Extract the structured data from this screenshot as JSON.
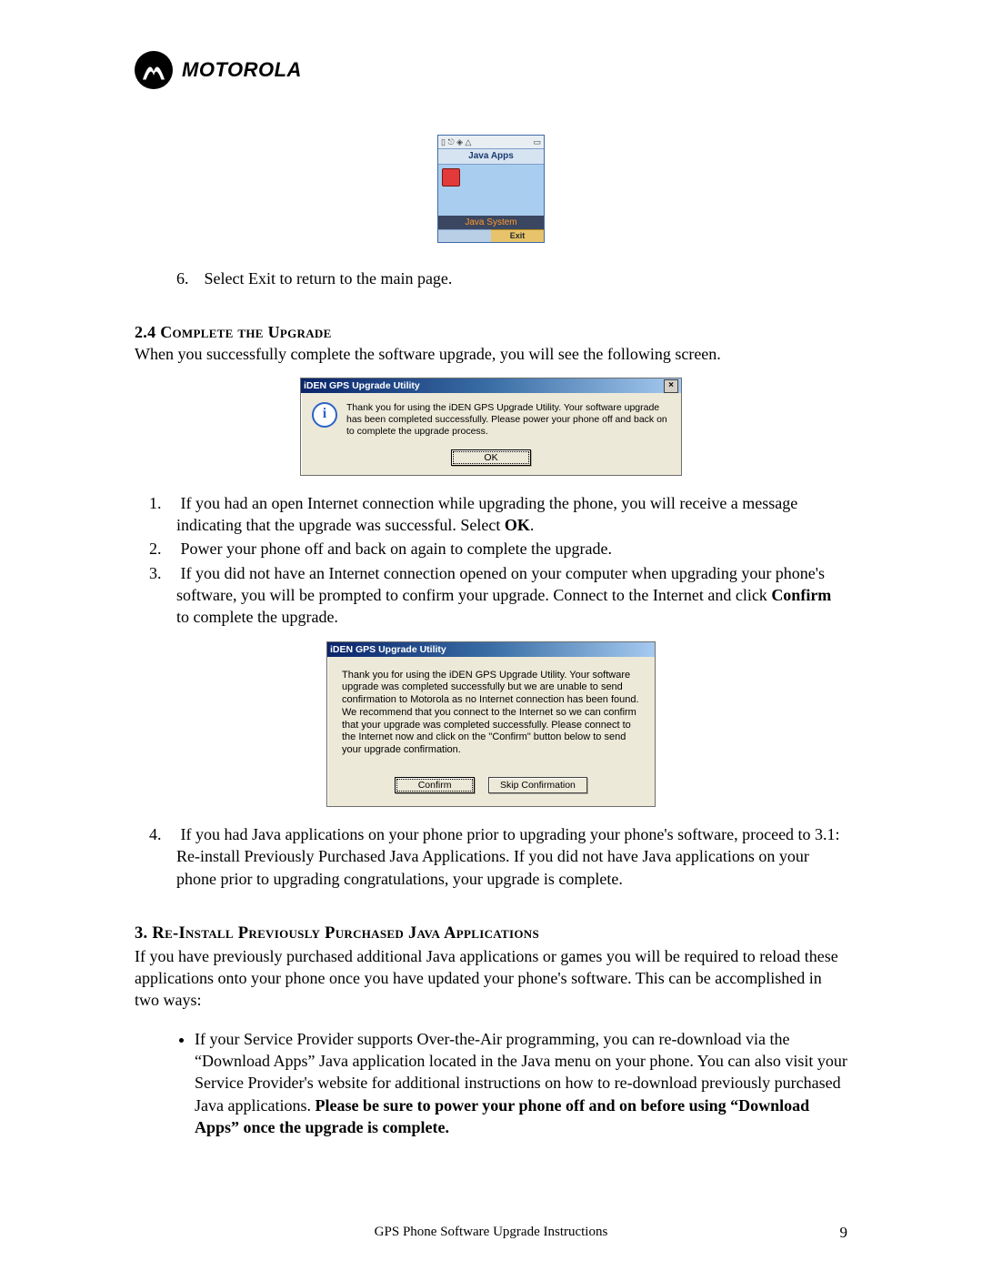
{
  "brand": {
    "wordmark": "MOTOROLA"
  },
  "phone": {
    "status_left": "▯  ⎋ ◈ △",
    "status_right": "▭",
    "title": "Java Apps",
    "highlight": "Java System",
    "softkey_left": "",
    "softkey_right": "Exit"
  },
  "step6": {
    "num": "6.",
    "text": "Select Exit to return to the main page."
  },
  "sec24": {
    "heading_num": "2.4",
    "heading_text": "Complete the Upgrade",
    "intro": "When you successfully complete the software upgrade, you will see the following screen."
  },
  "dlg_success": {
    "title": "iDEN GPS Upgrade Utility",
    "close": "×",
    "msg": "Thank you for using the iDEN GPS Upgrade Utility. Your software upgrade has been completed successfully. Please power your phone off and back on to complete the upgrade process.",
    "ok": "OK"
  },
  "steps24": {
    "s1_num": "1.",
    "s1_a": "If you had an open Internet connection while upgrading the phone, you will receive a message indicating that the upgrade was successful.  Select ",
    "s1_b": "OK",
    "s1_c": ".",
    "s2_num": "2.",
    "s2": "Power your phone off and back on again to complete the upgrade.",
    "s3_num": "3.",
    "s3_a": "If you did not have an Internet connection opened on your computer when upgrading your phone's software, you will be prompted to confirm your upgrade. Connect to the Internet and click ",
    "s3_b": "Confirm",
    "s3_c": " to complete the upgrade."
  },
  "dlg_confirm": {
    "title": "iDEN GPS Upgrade Utility",
    "msg": "Thank you for using the iDEN GPS Upgrade Utility. Your software upgrade was completed successfully but we are unable to send confirmation to Motorola as no Internet connection has been found. We recommend that you connect to the Internet so we can confirm that your upgrade was completed successfully. Please connect to the Internet now and click on the \"Confirm\" button below to send your upgrade confirmation.",
    "confirm": "Confirm",
    "skip": "Skip Confirmation"
  },
  "step4": {
    "num": "4.",
    "text": "If you had Java applications on your phone prior to upgrading your phone's software, proceed to 3.1: Re-install Previously Purchased Java Applications. If you did not have Java applications on your phone prior to upgrading congratulations, your upgrade is complete."
  },
  "sec3": {
    "heading_num": "3. ",
    "heading_text": "Re-Install Previously Purchased Java Applications",
    "intro": "If you have previously purchased additional Java applications or games you will be required to reload these applications onto your phone once you have updated your phone's software. This can be accomplished in two ways:"
  },
  "bullet1": {
    "a": "If your Service Provider supports Over-the-Air programming, you can re-download via the “Download Apps” Java application located in the Java menu on your phone. You can also visit your Service Provider's website for additional instructions on how to re-download previously purchased Java applications. ",
    "b": "Please be sure to power your phone off and on before using “Download Apps” once the upgrade is complete."
  },
  "footer": {
    "text": "GPS Phone Software Upgrade Instructions",
    "page": "9"
  }
}
